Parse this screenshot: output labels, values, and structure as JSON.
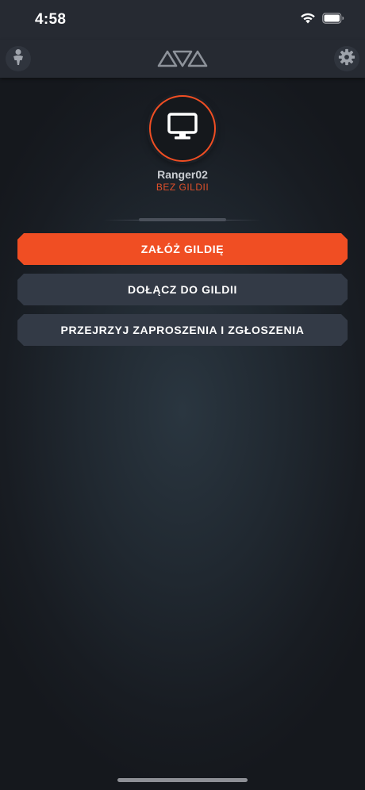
{
  "status_bar": {
    "time": "4:58",
    "icons": [
      "wifi-icon",
      "battery-icon"
    ]
  },
  "nav": {
    "left_icon": "user-icon",
    "right_icon": "gear-icon",
    "logo_icon": "triangles-logo-icon"
  },
  "profile": {
    "avatar_icon": "monitor-icon",
    "username": "Ranger02",
    "guild_status": "BEZ GILDII"
  },
  "actions": {
    "create_guild": "ZAŁÓŻ GILDIĘ",
    "join_guild": "DOŁĄCZ DO GILDII",
    "review_invites": "PRZEJRZYJ ZAPROSZENIA I ZGŁOSZENIA"
  },
  "colors": {
    "accent": "#f04e23",
    "button_secondary": "#333a46",
    "nav_background": "#262a32",
    "guild_status_text": "#e0502a"
  }
}
